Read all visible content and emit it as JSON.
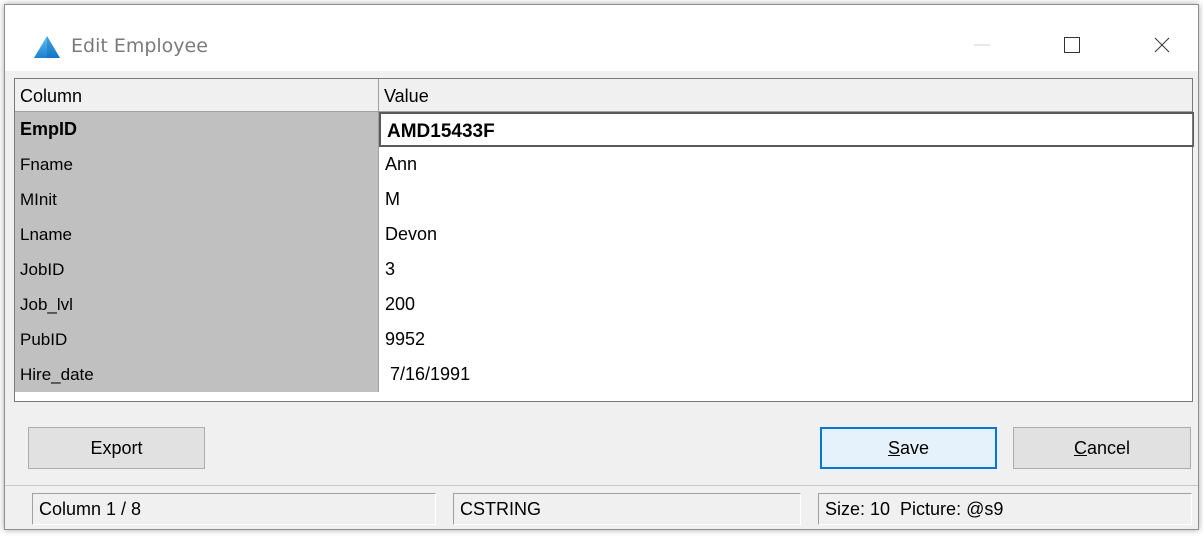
{
  "window": {
    "title": "Edit Employee",
    "accent": "#0078d7"
  },
  "icons": {
    "app": "app-triangle-icon",
    "minimize": "minimize-icon",
    "maximize": "maximize-icon",
    "close": "close-icon"
  },
  "grid": {
    "headers": {
      "column": "Column",
      "value": "Value"
    },
    "rows": [
      {
        "column": "EmpID",
        "value": "AMD15433F"
      },
      {
        "column": "Fname",
        "value": "Ann"
      },
      {
        "column": "MInit",
        "value": "M"
      },
      {
        "column": "Lname",
        "value": "Devon"
      },
      {
        "column": "JobID",
        "value": "3"
      },
      {
        "column": "Job_lvl",
        "value": "200"
      },
      {
        "column": "PubID",
        "value": "9952"
      },
      {
        "column": "Hire_date",
        "value": " 7/16/1991"
      }
    ],
    "selected_row": "EmpID"
  },
  "buttons": {
    "export": "Export",
    "save_mnemonic": "S",
    "save_rest": "ave",
    "cancel_mnemonic": "C",
    "cancel_rest": "ancel"
  },
  "status": {
    "position": "Column 1 / 8",
    "type": "CSTRING",
    "info": "Size: 10  Picture: @s9"
  }
}
